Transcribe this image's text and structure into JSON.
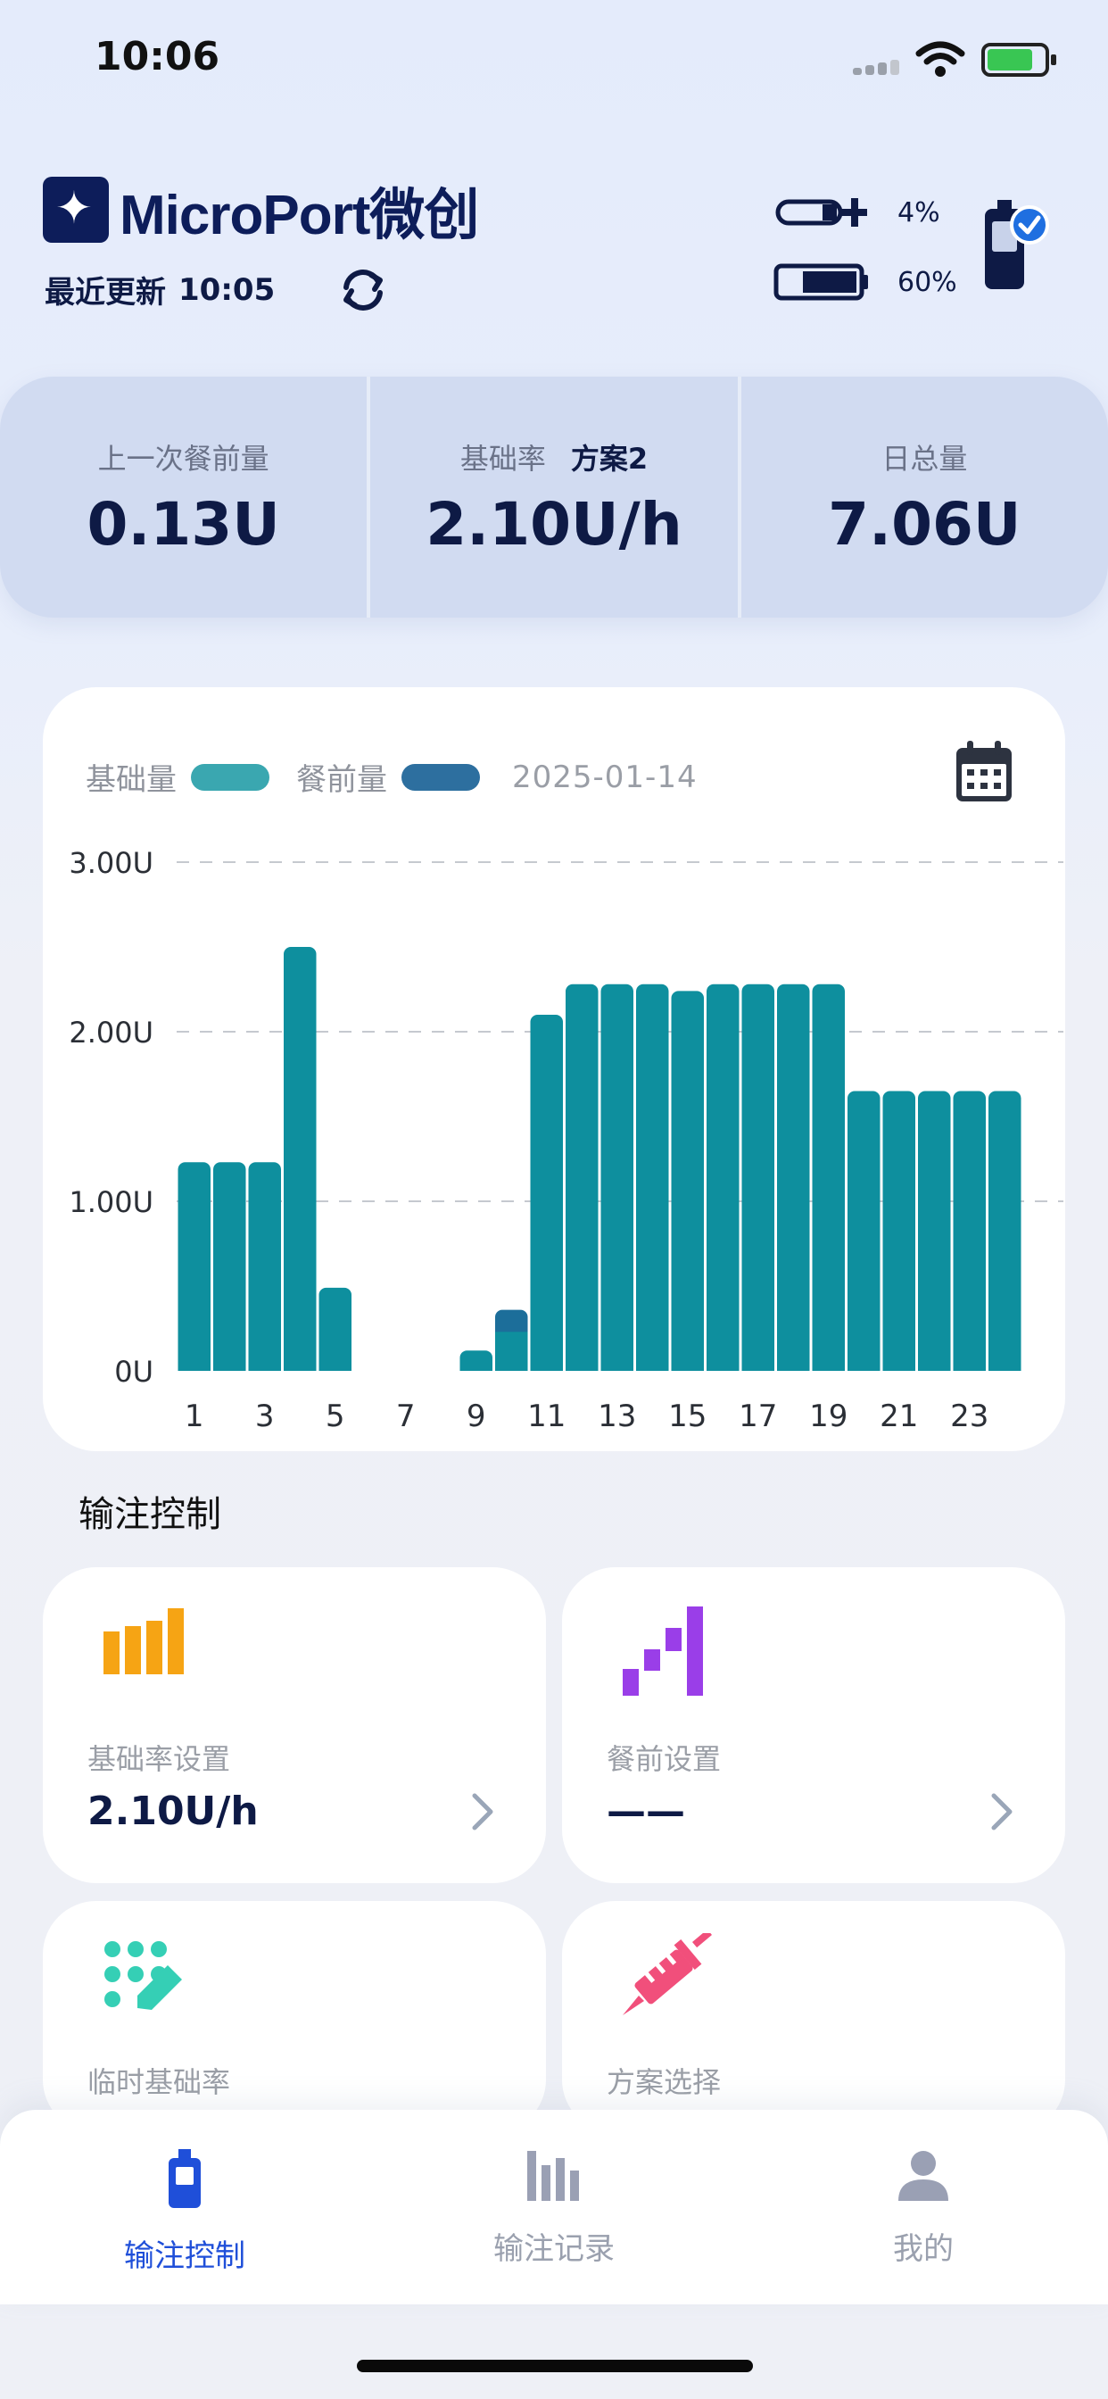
{
  "status_bar": {
    "time": "10:06"
  },
  "header": {
    "brand": "MicroPort微创",
    "update_label": "最近更新",
    "update_time": "10:05",
    "reservoir_percent": "4%",
    "pump_battery_percent": "60%"
  },
  "summary": [
    {
      "label": "上一次餐前量",
      "extra": "",
      "value": "0.13U"
    },
    {
      "label": "基础率",
      "extra": "方案2",
      "value": "2.10U/h"
    },
    {
      "label": "日总量",
      "extra": "",
      "value": "7.06U"
    }
  ],
  "chart_legend": {
    "basal_label": "基础量",
    "bolus_label": "餐前量",
    "date": "2025-01-14",
    "basal_color": "#0e8f9e",
    "bolus_color": "#1c6e9a"
  },
  "chart_data": {
    "type": "bar",
    "categories": [
      1,
      2,
      3,
      4,
      5,
      6,
      7,
      8,
      9,
      10,
      11,
      12,
      13,
      14,
      15,
      16,
      17,
      18,
      19,
      20,
      21,
      22,
      23,
      24
    ],
    "x_tick_labels": [
      "1",
      "3",
      "5",
      "7",
      "9",
      "11",
      "13",
      "15",
      "17",
      "19",
      "21",
      "23"
    ],
    "y_tick_labels": [
      "3.00U",
      "2.00U",
      "1.00U",
      "0U"
    ],
    "ylim": [
      0,
      3
    ],
    "grid": true,
    "stacked": true,
    "series": [
      {
        "name": "基础量",
        "values": [
          1.23,
          1.23,
          1.23,
          2.5,
          0.49,
          0,
          0,
          0,
          0.12,
          0.23,
          2.1,
          2.28,
          2.28,
          2.28,
          2.24,
          2.28,
          2.28,
          2.28,
          2.28,
          1.65,
          1.65,
          1.65,
          1.65,
          1.65
        ]
      },
      {
        "name": "餐前量",
        "values": [
          0,
          0,
          0,
          0,
          0,
          0,
          0,
          0,
          0,
          0.13,
          0,
          0,
          0,
          0,
          0,
          0,
          0,
          0,
          0,
          0,
          0,
          0,
          0,
          0
        ]
      }
    ]
  },
  "section_title": "输注控制",
  "controls": [
    {
      "label": "基础率设置",
      "value": "2.10U/h",
      "icon": "bar-steps-icon"
    },
    {
      "label": "餐前设置",
      "value": "——",
      "icon": "bolus-steps-icon"
    },
    {
      "label": "临时基础率",
      "value": "",
      "icon": "dot-grid-edit-icon"
    },
    {
      "label": "方案选择",
      "value": "",
      "icon": "syringe-icon"
    }
  ],
  "tabs": [
    {
      "label": "输注控制",
      "icon": "pump-icon",
      "active": true
    },
    {
      "label": "输注记录",
      "icon": "records-chart-icon",
      "active": false
    },
    {
      "label": "我的",
      "icon": "person-icon",
      "active": false
    }
  ]
}
